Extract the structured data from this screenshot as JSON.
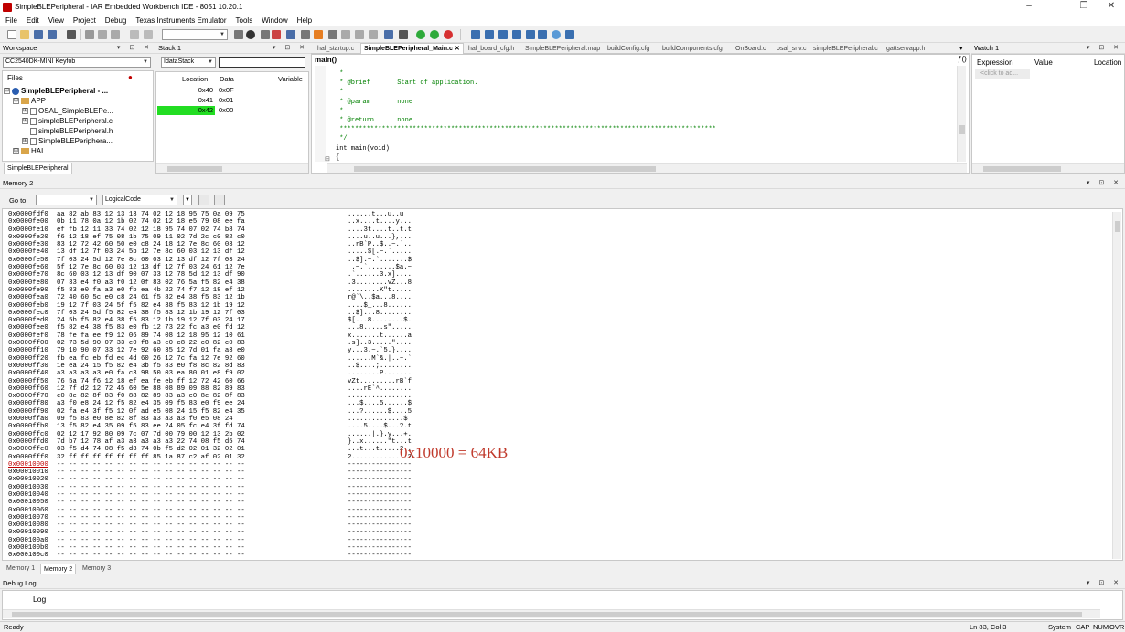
{
  "window": {
    "title": "SimpleBLEPeripheral - IAR Embedded Workbench IDE - 8051 10.20.1",
    "btn_min": "–",
    "btn_max": "❐",
    "btn_close": "✕"
  },
  "menu": [
    "File",
    "Edit",
    "View",
    "Project",
    "Debug",
    "Texas Instruments Emulator",
    "Tools",
    "Window",
    "Help"
  ],
  "workspace": {
    "title": "Workspace",
    "config": "CC2540DK-MINI Keyfob",
    "files_header": "Files",
    "tree": [
      {
        "indent": 0,
        "box": "⊟",
        "icon": "project",
        "label": "SimpleBLEPeripheral - ...",
        "bold": true
      },
      {
        "indent": 1,
        "box": "⊟",
        "icon": "folder",
        "label": "APP"
      },
      {
        "indent": 2,
        "box": "⊞",
        "icon": "file",
        "label": "OSAL_SimpleBLEPe..."
      },
      {
        "indent": 2,
        "box": "⊞",
        "icon": "file",
        "label": "simpleBLEPeripheral.c"
      },
      {
        "indent": 2,
        "box": "",
        "icon": "file",
        "label": "simpleBLEPeripheral.h"
      },
      {
        "indent": 2,
        "box": "⊞",
        "icon": "file",
        "label": "SimpleBLEPeriphera..."
      },
      {
        "indent": 1,
        "box": "⊞",
        "icon": "folder",
        "label": "HAL"
      }
    ],
    "bottom_tab": "SimpleBLEPeripheral"
  },
  "stack": {
    "title": "Stack 1",
    "selector": "IdataStack",
    "columns": [
      "Location",
      "Data",
      "Variable"
    ],
    "rows": [
      {
        "loc": "0x40",
        "data": "0x0F"
      },
      {
        "loc": "0x41",
        "data": "0x01"
      },
      {
        "loc": "0x42",
        "data": "0x00",
        "highlight": true
      }
    ]
  },
  "editor": {
    "tabs": [
      "hal_startup.c",
      "SimpleBLEPeripheral_Main.c",
      "hal_board_cfg.h",
      "SimpleBLEPeripheral.map",
      "buildConfig.cfg",
      "buildComponents.cfg",
      "OnBoard.c",
      "osal_snv.c",
      "simpleBLEPeripheral.c",
      "gattservapp.h"
    ],
    "active_tab": "SimpleBLEPeripheral_Main.c",
    "function": "main()",
    "code_lines": [
      {
        "t": " *",
        "c": "comment"
      },
      {
        "t": " * @brief       Start of application.",
        "c": "comment"
      },
      {
        "t": " *",
        "c": "comment"
      },
      {
        "t": " * @param       none",
        "c": "comment"
      },
      {
        "t": " *",
        "c": "comment"
      },
      {
        "t": " * @return      none",
        "c": "comment"
      },
      {
        "t": " **************************************************************************************************",
        "c": "comment"
      },
      {
        "t": " */",
        "c": "comment"
      },
      {
        "t": "int main(void)",
        "c": "plain"
      },
      {
        "t": "{",
        "c": "plain"
      }
    ]
  },
  "watch": {
    "title": "Watch 1",
    "columns": [
      "Expression",
      "Value",
      "Location"
    ],
    "placeholder": "<click to ad..."
  },
  "memory": {
    "title": "Memory 2",
    "goto_label": "Go to",
    "zone": "LogicalCode",
    "annotation": "0x10000 = 64KB",
    "tabs": [
      "Memory 1",
      "Memory 2",
      "Memory 3"
    ],
    "rows": [
      {
        "a": "0x0000fdf0",
        "h": "aa 82 ab 83 12 13 13 74 02 12 18 95 75 0a 09 75",
        "s": "......t...u..u"
      },
      {
        "a": "0x0000fe00",
        "h": "0b 11 78 0a 12 1b 02 74 02 12 18 e5 79 08 ee fa",
        "s": "..x....t....y..."
      },
      {
        "a": "0x0000fe10",
        "h": "ef fb 12 11 33 74 02 12 18 95 74 07 02 74 b8 74",
        "s": "....3t....t..t.t"
      },
      {
        "a": "0x0000fe20",
        "h": "f6 12 18 ef 75 08 1b 75 09 11 02 7d 2c c0 82 c0",
        "s": "....u..u...},..."
      },
      {
        "a": "0x0000fe30",
        "h": "83 12 72 42 60 50 e0 c8 24 18 12 7e 8c 60 03 12",
        "s": "..rB`P..$..~.`.."
      },
      {
        "a": "0x0000fe40",
        "h": "13 df 12 7f 03 24 5b 12 7e 8c 60 03 12 13 df 12",
        "s": ".....$[.~.`....."
      },
      {
        "a": "0x0000fe50",
        "h": "7f 03 24 5d 12 7e 8c 60 03 12 13 df 12 7f 03 24",
        "s": "..$].~.`.......$"
      },
      {
        "a": "0x0000fe60",
        "h": "5f 12 7e 8c 60 03 12 13 df 12 7f 03 24 61 12 7e",
        "s": "_.~.`.......$a.~"
      },
      {
        "a": "0x0000fe70",
        "h": "8c 60 03 12 13 df 90 07 33 12 78 5d 12 13 df 90",
        "s": ".`......3.x]...."
      },
      {
        "a": "0x0000fe80",
        "h": "07 33 e4 f0 a3 f0 12 0f 83 02 76 5a f5 82 e4 38",
        "s": ".3........vZ...8"
      },
      {
        "a": "0x0000fe90",
        "h": "f5 83 e0 fa a3 e0 fb ea 4b 22 74 f7 12 18 ef 12",
        "s": "........K\"t....."
      },
      {
        "a": "0x0000fea0",
        "h": "72 40 60 5c e0 c8 24 61 f5 82 e4 38 f5 83 12 1b",
        "s": "r@`\\..$a...8...."
      },
      {
        "a": "0x0000feb0",
        "h": "19 12 7f 03 24 5f f5 82 e4 38 f5 83 12 1b 19 12",
        "s": "....$_...8......"
      },
      {
        "a": "0x0000fec0",
        "h": "7f 03 24 5d f5 82 e4 38 f5 83 12 1b 19 12 7f 03",
        "s": "..$]...8........"
      },
      {
        "a": "0x0000fed0",
        "h": "24 5b f5 82 e4 38 f5 83 12 1b 19 12 7f 03 24 17",
        "s": "$[...8........$."
      },
      {
        "a": "0x0000fee0",
        "h": "f5 82 e4 38 f5 83 e0 fb 12 73 22 fc a3 e0 fd 12",
        "s": "...8.....s\"....."
      },
      {
        "a": "0x0000fef0",
        "h": "78 fe fa ee f9 12 06 89 74 08 12 18 95 12 10 61",
        "s": "x.......t......a"
      },
      {
        "a": "0x0000ff00",
        "h": "02 73 5d 90 07 33 e0 f8 a3 e0 c8 22 c0 82 c0 83",
        "s": ".s]..3.....\"...."
      },
      {
        "a": "0x0000ff10",
        "h": "79 10 90 07 33 12 7e 92 60 35 12 7d 01 fa a3 e0",
        "s": "y...3.~.`5.}...."
      },
      {
        "a": "0x0000ff20",
        "h": "fb ea fc eb fd ec 4d 60 26 12 7c fa 12 7e 92 60",
        "s": "......M`&.|..~.`"
      },
      {
        "a": "0x0000ff30",
        "h": "1e ea 24 15 f5 82 e4 3b f5 83 e0 f8 8c 82 8d 83",
        "s": "..$....;........"
      },
      {
        "a": "0x0000ff40",
        "h": "a3 a3 a3 a3 e0 fa c3 98 50 03 ea 80 01 e8 f9 02",
        "s": "........P......."
      },
      {
        "a": "0x0000ff50",
        "h": "76 5a 74 f6 12 18 ef ea fe eb ff 12 72 42 60 66",
        "s": "vZt.........rB`f"
      },
      {
        "a": "0x0000ff60",
        "h": "12 7f d2 12 72 45 60 5e 88 08 89 09 88 82 89 83",
        "s": "....rE`^........"
      },
      {
        "a": "0x0000ff70",
        "h": "e0 8e 82 8f 83 f0 88 82 89 83 a3 e0 8e 82 8f 83",
        "s": "................"
      },
      {
        "a": "0x0000ff80",
        "h": "a3 f0 e8 24 12 f5 82 e4 35 09 f5 83 e0 f9 ee 24",
        "s": "...$....5......$"
      },
      {
        "a": "0x0000ff90",
        "h": "02 fa e4 3f f5 12 0f ad e5 08 24 15 f5 82 e4 35",
        "s": "...?......$....5"
      },
      {
        "a": "0x0000ffa0",
        "h": "09 f5 83 e0 8e 82 8f 83 a3 a3 a3 f0 e5 08 24",
        "s": "..............$"
      },
      {
        "a": "0x0000ffb0",
        "h": "13 f5 82 e4 35 09 f5 83 ee 24 05 fc e4 3f fd 74",
        "s": "....5....$...?.t"
      },
      {
        "a": "0x0000ffc0",
        "h": "02 12 17 92 80 09 7c 07 7d 00 79 00 12 13 2b 02",
        "s": "......|.}.y...+."
      },
      {
        "a": "0x0000ffd0",
        "h": "7d b7 12 78 af a3 a3 a3 a3 a3 22 74 08 f5 d5 74",
        "s": "}..x......\"t...t"
      },
      {
        "a": "0x0000ffe0",
        "h": "03 f5 d4 74 08 f5 d3 74 0b f5 d2 02 01 32 02 01",
        "s": "...t...t.....2.."
      },
      {
        "a": "0x0000fff0",
        "h": "32 ff ff ff ff ff ff ff 85 1a 87 c2 af 02 01 32",
        "s": "2..............2"
      },
      {
        "a": "0x00010000",
        "h": "-- -- -- -- -- -- -- -- -- -- -- -- -- -- -- --",
        "s": "----------------",
        "hi": true
      },
      {
        "a": "0x00010010",
        "h": "-- -- -- -- -- -- -- -- -- -- -- -- -- -- -- --",
        "s": "----------------"
      },
      {
        "a": "0x00010020",
        "h": "-- -- -- -- -- -- -- -- -- -- -- -- -- -- -- --",
        "s": "----------------"
      },
      {
        "a": "0x00010030",
        "h": "-- -- -- -- -- -- -- -- -- -- -- -- -- -- -- --",
        "s": "----------------"
      },
      {
        "a": "0x00010040",
        "h": "-- -- -- -- -- -- -- -- -- -- -- -- -- -- -- --",
        "s": "----------------"
      },
      {
        "a": "0x00010050",
        "h": "-- -- -- -- -- -- -- -- -- -- -- -- -- -- -- --",
        "s": "----------------"
      },
      {
        "a": "0x00010060",
        "h": "-- -- -- -- -- -- -- -- -- -- -- -- -- -- -- --",
        "s": "----------------"
      },
      {
        "a": "0x00010070",
        "h": "-- -- -- -- -- -- -- -- -- -- -- -- -- -- -- --",
        "s": "----------------"
      },
      {
        "a": "0x00010080",
        "h": "-- -- -- -- -- -- -- -- -- -- -- -- -- -- -- --",
        "s": "----------------"
      },
      {
        "a": "0x00010090",
        "h": "-- -- -- -- -- -- -- -- -- -- -- -- -- -- -- --",
        "s": "----------------"
      },
      {
        "a": "0x000100a0",
        "h": "-- -- -- -- -- -- -- -- -- -- -- -- -- -- -- --",
        "s": "----------------"
      },
      {
        "a": "0x000100b0",
        "h": "-- -- -- -- -- -- -- -- -- -- -- -- -- -- -- --",
        "s": "----------------"
      },
      {
        "a": "0x000100c0",
        "h": "-- -- -- -- -- -- -- -- -- -- -- -- -- -- -- --",
        "s": "----------------"
      }
    ]
  },
  "debuglog": {
    "title": "Debug Log",
    "column": "Log"
  },
  "status": {
    "left": "Ready",
    "pos": "Ln 83, Col 3",
    "system": "System",
    "caps": "CAP",
    "num": "NUM",
    "ovr": "OVR"
  },
  "colors": {
    "highlight": "#22dd22",
    "annotation": "#c0392b"
  }
}
